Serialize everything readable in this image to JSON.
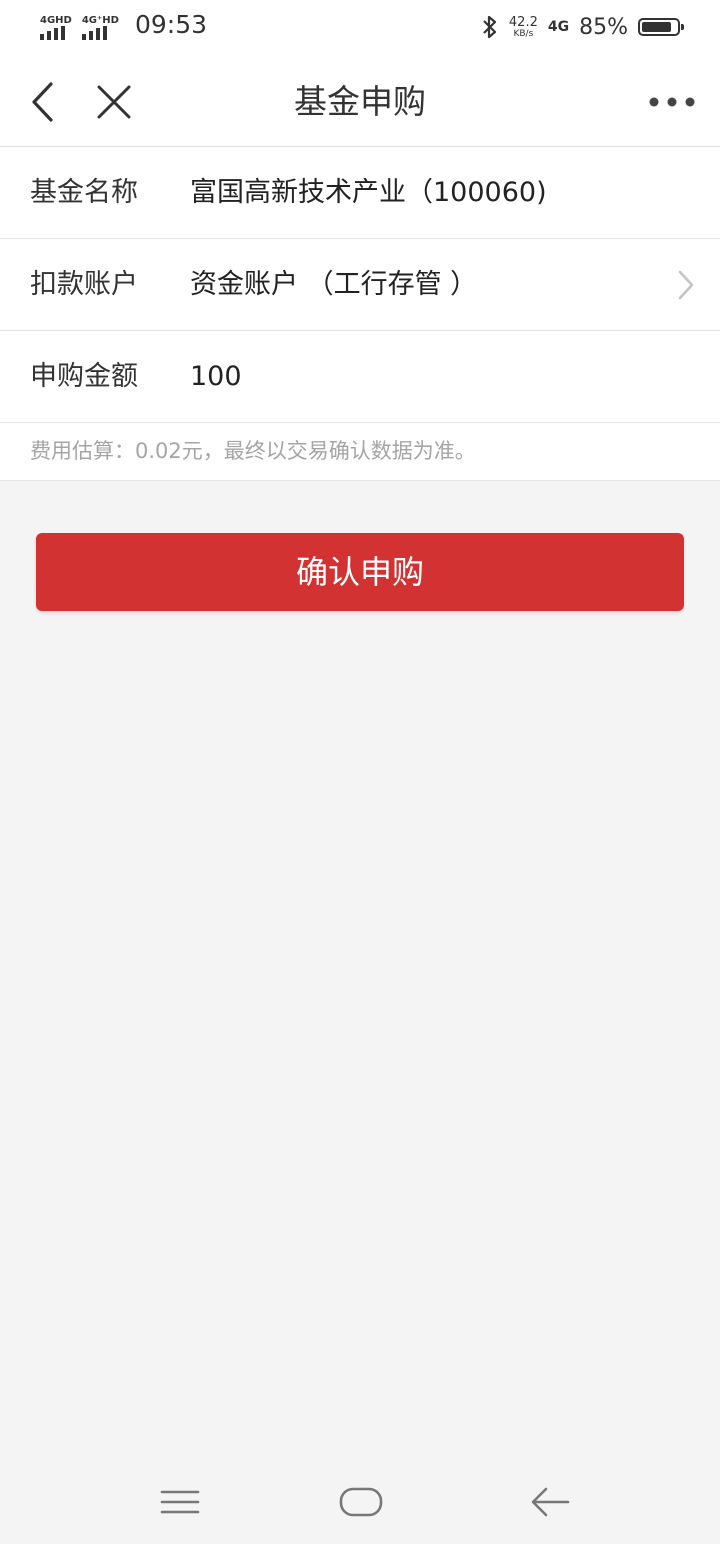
{
  "status": {
    "sim1": "4GHD",
    "sim2": "4G⁺HD",
    "time": "09:53",
    "speed_value": "42.2",
    "speed_unit": "KB/s",
    "network": "4G",
    "battery_text": "85%",
    "battery_level": 0.85
  },
  "nav": {
    "title": "基金申购",
    "back_icon": "chevron-left-icon",
    "close_icon": "close-icon",
    "more_icon": "more-horizontal-icon"
  },
  "form": {
    "fund_name_label": "基金名称",
    "fund_name_value": "富国高新技术产业（100060)",
    "account_label": "扣款账户",
    "account_value": "资金账户 （工行存管 ）",
    "amount_label": "申购金额",
    "amount_value": "100"
  },
  "fee_note": "费用估算：0.02元，最终以交易确认数据为准。",
  "confirm_label": "确认申购",
  "colors": {
    "accent": "#d23232",
    "background": "#f4f4f4",
    "hint_text": "#a5a5a5"
  }
}
